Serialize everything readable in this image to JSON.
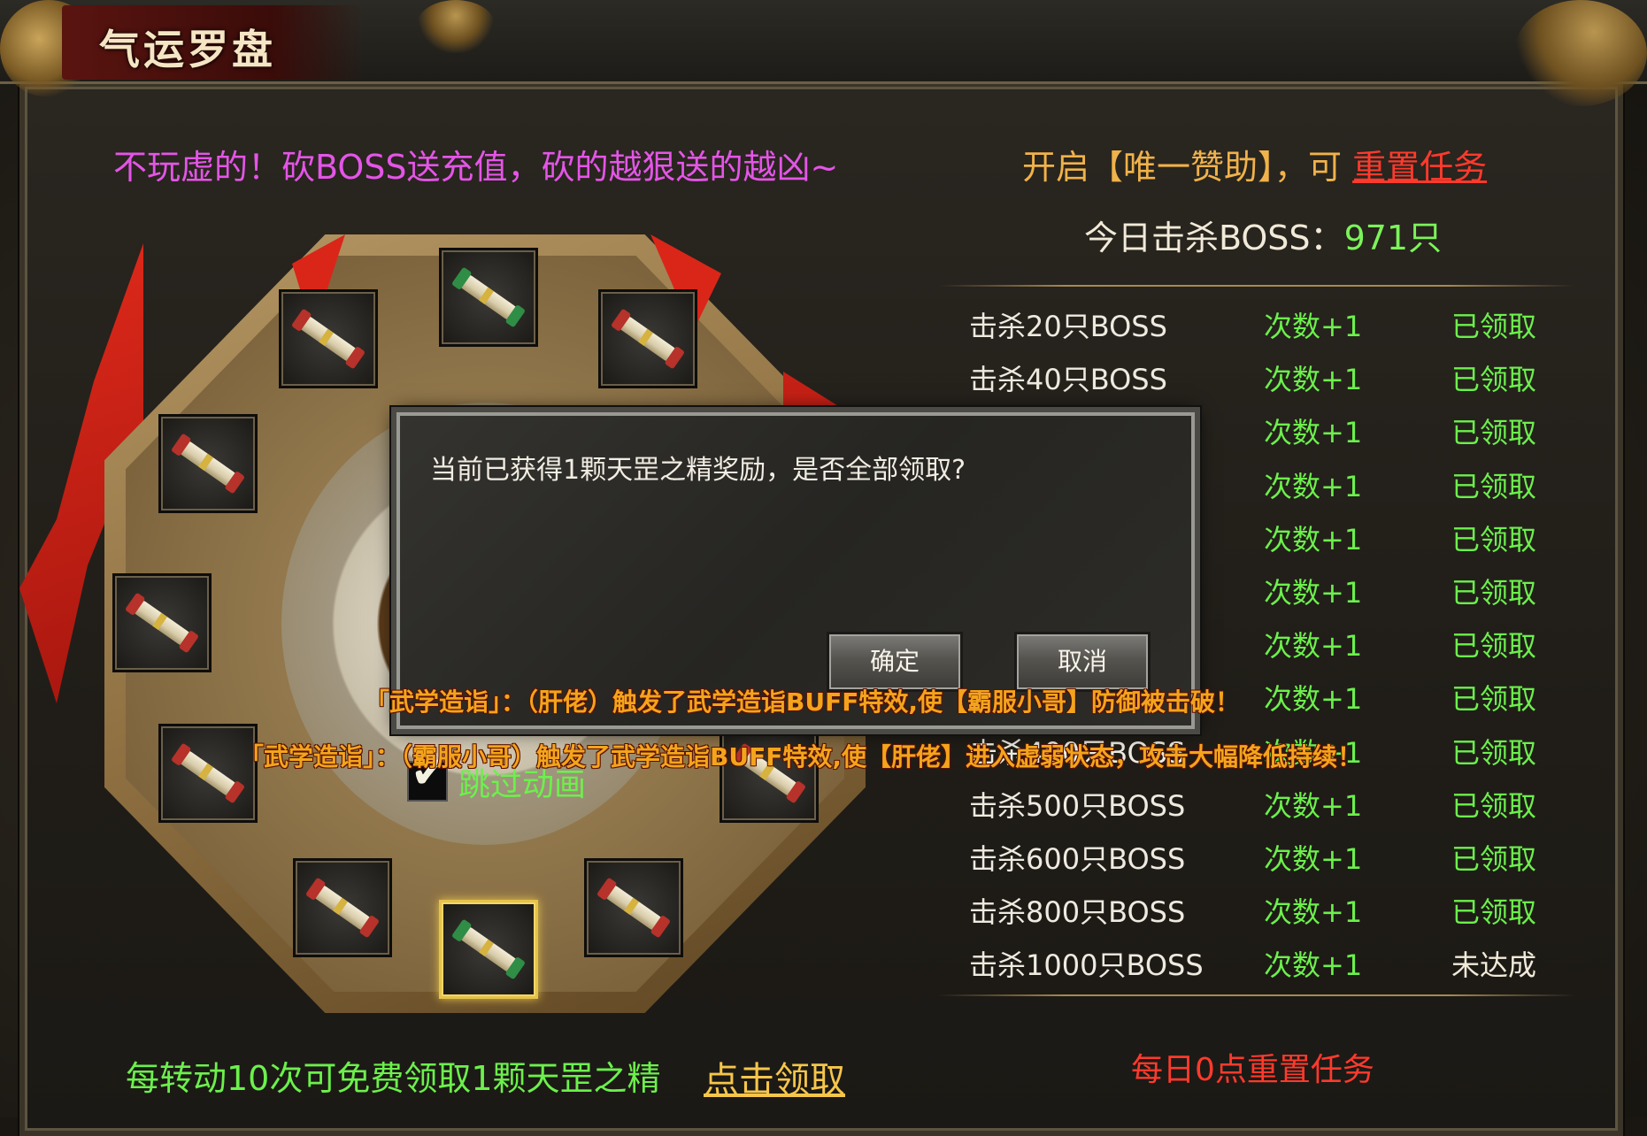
{
  "window": {
    "title": "气运罗盘"
  },
  "header": {
    "promo_text": "不玩虚的！砍BOSS送充值，砍的越狠送的越凶~",
    "sponsor_prefix": "开启【唯一赞助】，可 ",
    "sponsor_link": "重置任务"
  },
  "kill_stats": {
    "label": "今日击杀BOSS：",
    "value": "971只"
  },
  "tasks": [
    {
      "name": "击杀20只BOSS",
      "reward": "次数+1",
      "status": "已领取"
    },
    {
      "name": "击杀40只BOSS",
      "reward": "次数+1",
      "status": "已领取"
    },
    {
      "name": "",
      "reward": "次数+1",
      "status": "已领取"
    },
    {
      "name": "",
      "reward": "次数+1",
      "status": "已领取"
    },
    {
      "name": "",
      "reward": "次数+1",
      "status": "已领取"
    },
    {
      "name": "",
      "reward": "次数+1",
      "status": "已领取"
    },
    {
      "name": "",
      "reward": "次数+1",
      "status": "已领取"
    },
    {
      "name": "",
      "reward": "次数+1",
      "status": "已领取"
    },
    {
      "name": "击杀400只BOSS",
      "reward": "次数+1",
      "status": "已领取"
    },
    {
      "name": "击杀500只BOSS",
      "reward": "次数+1",
      "status": "已领取"
    },
    {
      "name": "击杀600只BOSS",
      "reward": "次数+1",
      "status": "已领取"
    },
    {
      "name": "击杀800只BOSS",
      "reward": "次数+1",
      "status": "已领取"
    },
    {
      "name": "击杀1000只BOSS",
      "reward": "次数+1",
      "status": "未达成"
    }
  ],
  "footer": {
    "reset_note": "每日0点重置任务",
    "free_note": "每转动10次可免费领取1颗天罡之精",
    "claim_link": "点击领取"
  },
  "compass": {
    "skip_label": "跳过动画",
    "skip_checked": true,
    "slots": [
      "scroll-icon",
      "scroll-icon",
      "scroll-icon",
      "scroll-icon",
      "scroll-icon",
      "scroll-icon",
      "scroll-icon",
      "scroll-icon",
      "scroll-icon",
      "scroll-icon",
      "scroll-icon"
    ]
  },
  "dialog": {
    "message": "当前已获得1颗天罡之精奖励，是否全部领取?",
    "ok_label": "确定",
    "cancel_label": "取消"
  },
  "combat_log": [
    "「武学造诣」：（肝佬）触发了武学造诣BUFF特效,使【霸服小哥】防御被击破！",
    "「武学造诣」：（霸服小哥）触发了武学造诣BUFF特效,使【肝佬】进入虚弱状态，攻击大幅降低持续！"
  ],
  "colors": {
    "promo": "#e455e7",
    "sponsor": "#f0b24a",
    "link_red": "#ff3a2c",
    "green": "#6cf04c",
    "combat": "#f3a41c"
  }
}
